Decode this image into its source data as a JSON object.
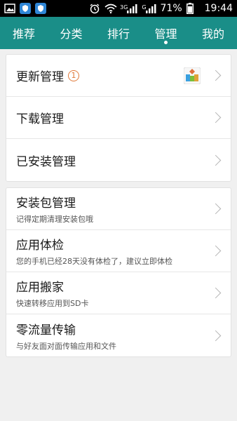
{
  "status_bar": {
    "left_icons": [
      "image-icon",
      "shield-app-icon",
      "shield-app-icon-2"
    ],
    "right_icons": [
      "alarm-icon",
      "wifi-icon",
      "signal-3g-icon",
      "signal-g-icon",
      "battery-icon"
    ],
    "net_3g": "3G",
    "net_g": "G",
    "battery": "71%",
    "time": "19:44"
  },
  "tabs": [
    {
      "label": "推荐"
    },
    {
      "label": "分类"
    },
    {
      "label": "排行"
    },
    {
      "label": "管理",
      "active": true
    },
    {
      "label": "我的"
    }
  ],
  "group1": {
    "update": {
      "title": "更新管理",
      "badge": "1",
      "app_icon": "wps-app-icon"
    },
    "download": {
      "title": "下载管理"
    },
    "installed": {
      "title": "已安装管理"
    }
  },
  "group2": {
    "apk": {
      "title": "安装包管理",
      "sub": "记得定期清理安装包哦"
    },
    "checkup": {
      "title": "应用体检",
      "sub": "您的手机已经28天没有体检了，建议立即体检"
    },
    "move": {
      "title": "应用搬家",
      "sub": "快速转移应用到SD卡"
    },
    "transfer": {
      "title": "零流量传输",
      "sub": "与好友面对面传输应用和文件"
    }
  },
  "colors": {
    "header_bg": "#1a8e88",
    "badge": "#e07a3a"
  }
}
